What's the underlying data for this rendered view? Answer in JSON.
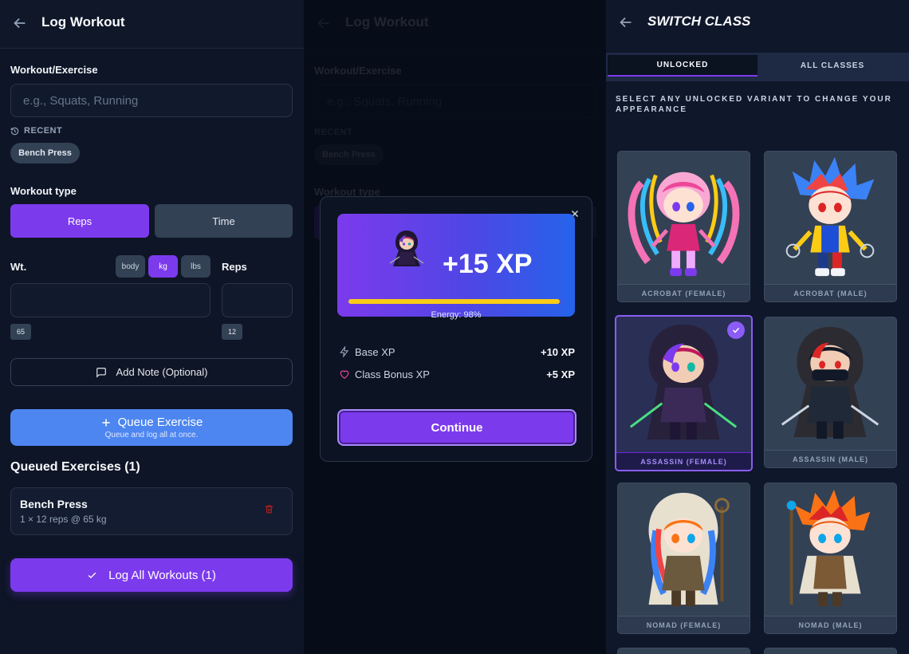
{
  "log": {
    "title": "Log Workout",
    "exercise_label": "Workout/Exercise",
    "exercise_placeholder": "e.g., Squats, Running",
    "recent_label": "RECENT",
    "recent_chip": "Bench Press",
    "type_label": "Workout type",
    "type_reps": "Reps",
    "type_time": "Time",
    "weight_label": "Wt.",
    "unit_body": "body",
    "unit_kg": "kg",
    "unit_lbs": "lbs",
    "reps_label": "Reps",
    "weight_hint": "65",
    "reps_hint": "12",
    "note_label": "Add Note (Optional)",
    "queue_label": "Queue Exercise",
    "queue_sub": "Queue and log all at once.",
    "queued_heading": "Queued Exercises (1)",
    "queued_item_title": "Bench Press",
    "queued_item_detail": "1 × 12 reps @ 65 kg",
    "log_all_label": "Log All Workouts (1)"
  },
  "modal": {
    "xp_gain": "+15 XP",
    "energy_text": "Energy: 98%",
    "energy_fraction": 0.98,
    "base_label": "Base XP",
    "base_value": "+10 XP",
    "bonus_label": "Class Bonus XP",
    "bonus_value": "+5 XP",
    "continue_label": "Continue"
  },
  "switch": {
    "title": "SWITCH CLASS",
    "tab_unlocked": "UNLOCKED",
    "tab_all": "ALL CLASSES",
    "hint": "SELECT ANY UNLOCKED VARIANT TO CHANGE YOUR APPEARANCE",
    "classes": [
      {
        "name": "ACROBAT (FEMALE)"
      },
      {
        "name": "ACROBAT (MALE)"
      },
      {
        "name": "ASSASSIN (FEMALE)"
      },
      {
        "name": "ASSASSIN (MALE)"
      },
      {
        "name": "NOMAD (FEMALE)"
      },
      {
        "name": "NOMAD (MALE)"
      }
    ]
  },
  "colors": {
    "accent": "#7c3aed",
    "queue_blue": "#4d86f0",
    "energy_bar": "#facc15"
  }
}
